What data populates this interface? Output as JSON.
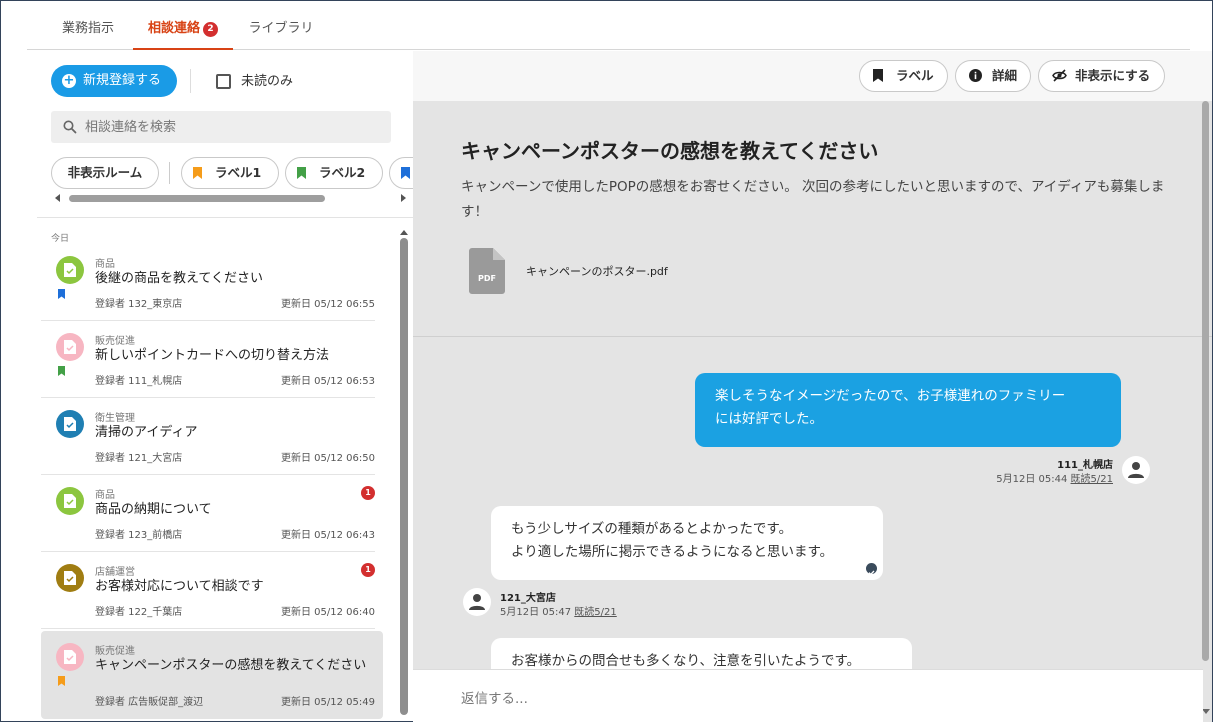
{
  "tabs": [
    {
      "label": "業務指示"
    },
    {
      "label": "相談連絡",
      "badge": "2",
      "active": true
    },
    {
      "label": "ライブラリ"
    }
  ],
  "sidebar": {
    "new_button": "新規登録する",
    "unread_only": "未読のみ",
    "search_placeholder": "相談連絡を検索",
    "chips": [
      {
        "label": "非表示ルーム"
      },
      {
        "label": "ラベル1",
        "color": "#f59c1a"
      },
      {
        "label": "ラベル2",
        "color": "#43a047"
      },
      {
        "label": "",
        "color": "#1e6fd9"
      }
    ],
    "section_today": "今日",
    "items": [
      {
        "category": "商品",
        "title": "後継の商品を教えてください",
        "registrant": "登録者 132_東京店",
        "updated": "更新日 05/12 06:55",
        "avatar_color": "#8cc63f",
        "flag_color": "#1e6fd9",
        "badge": ""
      },
      {
        "category": "販売促進",
        "title": "新しいポイントカードへの切り替え方法",
        "registrant": "登録者 111_札幌店",
        "updated": "更新日 05/12 06:53",
        "avatar_color": "#f7b6c2",
        "flag_color": "#43a047",
        "badge": ""
      },
      {
        "category": "衛生管理",
        "title": "清掃のアイディア",
        "registrant": "登録者 121_大宮店",
        "updated": "更新日 05/12 06:50",
        "avatar_color": "#1f7fb3",
        "flag_color": "",
        "badge": ""
      },
      {
        "category": "商品",
        "title": "商品の納期について",
        "registrant": "登録者 123_前橋店",
        "updated": "更新日 05/12 06:43",
        "avatar_color": "#8cc63f",
        "flag_color": "",
        "badge": "1"
      },
      {
        "category": "店舗運営",
        "title": "お客様対応について相談です",
        "registrant": "登録者 122_千葉店",
        "updated": "更新日 05/12 06:40",
        "avatar_color": "#a07d12",
        "flag_color": "",
        "badge": "1"
      },
      {
        "category": "販売促進",
        "title": "キャンペーンポスターの感想を教えてください",
        "registrant": "登録者 広告販促部_渡辺",
        "updated": "更新日 05/12 05:49",
        "avatar_color": "#f7b6c2",
        "flag_color": "#f59c1a",
        "badge": "",
        "selected": true
      }
    ]
  },
  "toolbar": {
    "label_btn": "ラベル",
    "detail_btn": "詳細",
    "hide_btn": "非表示にする"
  },
  "post": {
    "title": "キャンペーンポスターの感想を教えてください",
    "body": "キャンペーンで使用したPOPの感想をお寄せください。 次回の参考にしたいと思いますので、アイディアも募集します！",
    "attachment_icon_label": "PDF",
    "attachment_name": "キャンペーンのポスター.pdf"
  },
  "messages": [
    {
      "text_line1": "楽しそうなイメージだったので、お子様連れのファミリー",
      "text_line2": "には好評でした。",
      "author": "111_札幌店",
      "time": "5月12日 05:44",
      "read": "既読5/21"
    },
    {
      "text_line1": "もう少しサイズの種類があるとよかったです。",
      "text_line2": "より適した場所に掲示できるようになると思います。",
      "author": "121_大宮店",
      "time": "5月12日 05:47",
      "read": "既読5/21"
    },
    {
      "text_line1": "お客様からの問合せも多くなり、注意を引いたようです。"
    }
  ],
  "reply": {
    "placeholder": "返信する..."
  }
}
